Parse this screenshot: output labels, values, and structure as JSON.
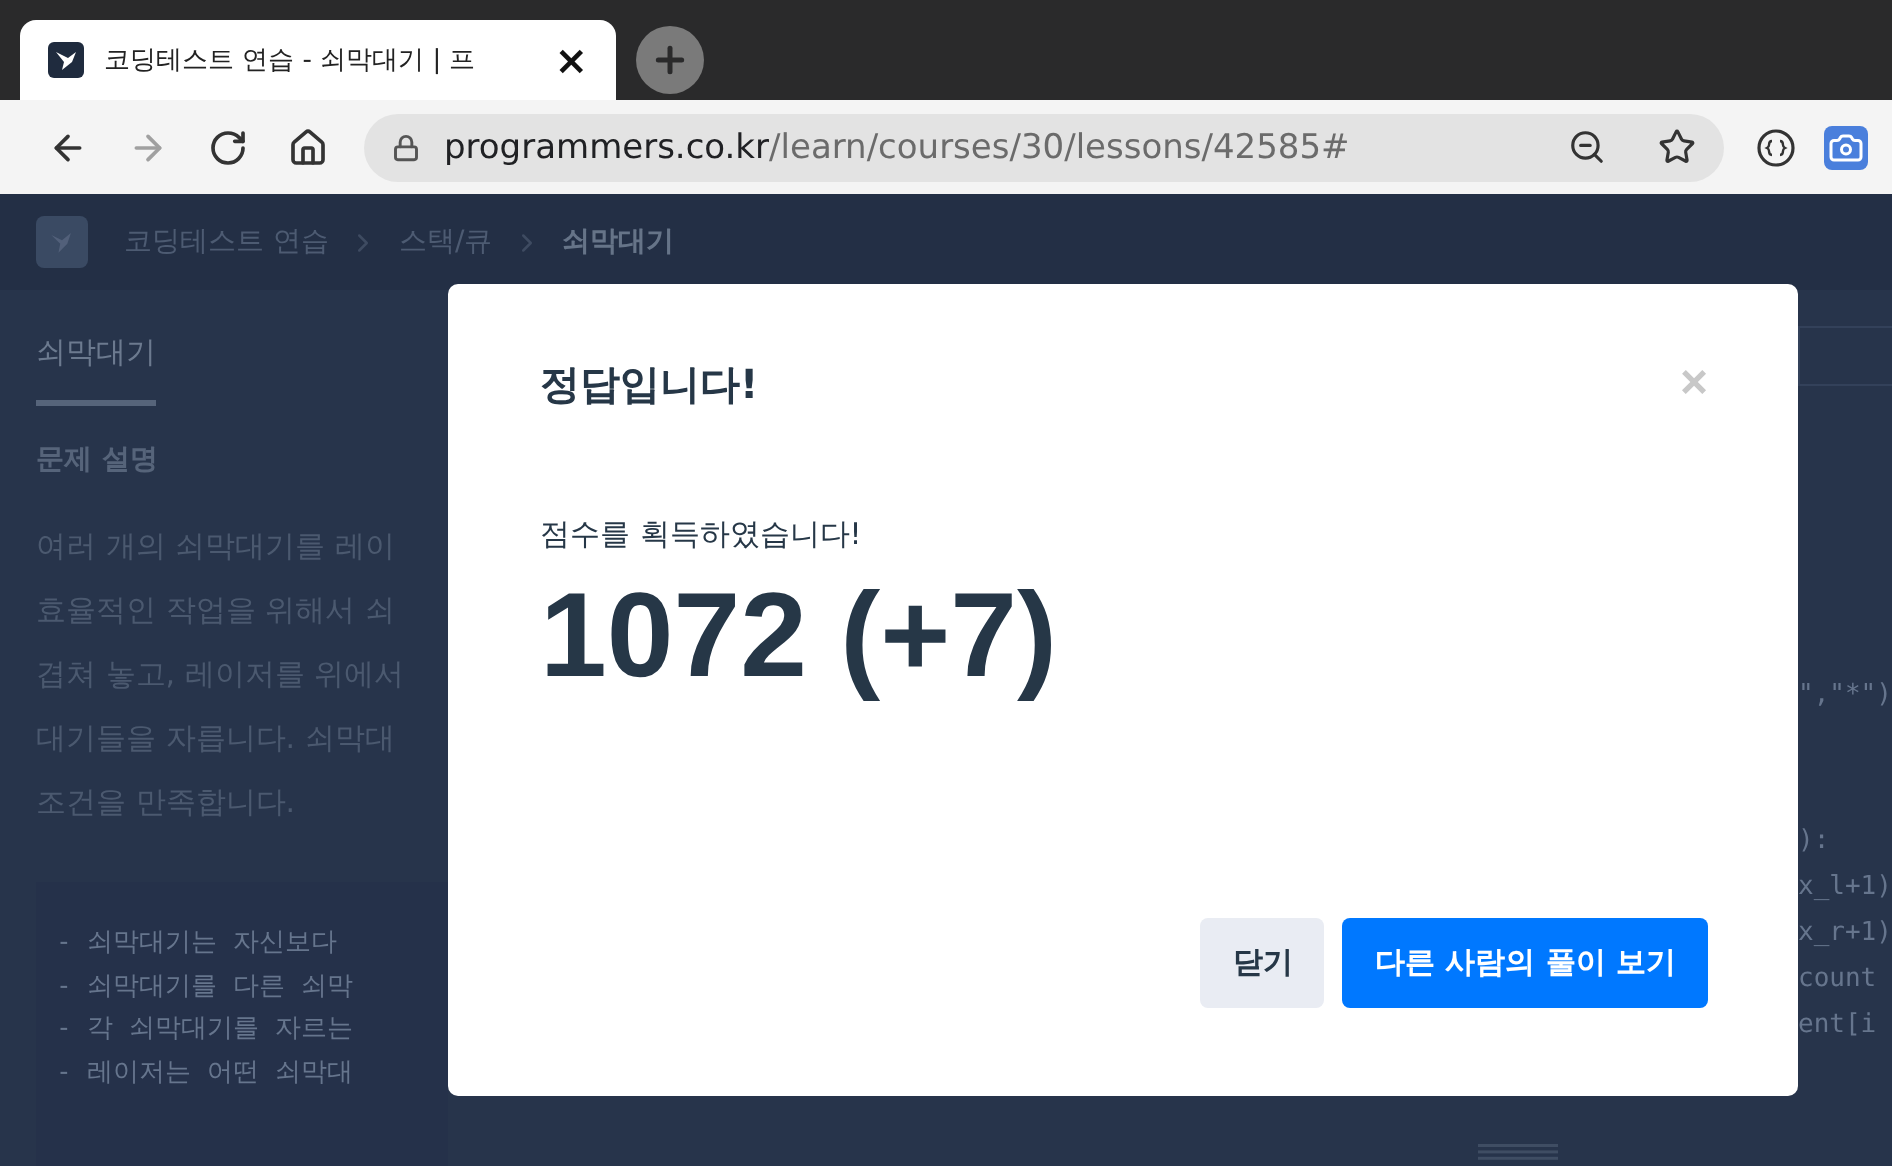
{
  "browser": {
    "tab": {
      "title": "코딩테스트 연습 - 쇠막대기 | 프",
      "close": "×"
    },
    "nav": [
      {
        "kind": "back",
        "disabled": false
      },
      {
        "kind": "forward",
        "disabled": true
      },
      {
        "kind": "reload",
        "disabled": false
      },
      {
        "kind": "home",
        "disabled": false
      }
    ],
    "address": {
      "host": "programmers.co.kr",
      "path": "/learn/courses/30/lessons/42585#"
    }
  },
  "page": {
    "breadcrumb": [
      {
        "label": "코딩테스트 연습",
        "current": false
      },
      {
        "label": "스택/큐",
        "current": false
      },
      {
        "label": "쇠막대기",
        "current": true
      }
    ],
    "tabs": [
      {
        "label": "쇠막대기",
        "selected": true
      }
    ],
    "section_title": "문제 설명",
    "paragraph_lines": [
      "여러 개의 쇠막대기를 레이",
      "효율적인 작업을 위해서 쇠",
      "겹쳐 놓고, 레이저를 위에서",
      "대기들을 자릅니다. 쇠막대",
      "조건을 만족합니다."
    ],
    "condition_lines": [
      "- 쇠막대기는 자신보다",
      "- 쇠막대기를 다른 쇠막",
      "- 각 쇠막대기를 자르는",
      "- 레이저는 어떤 쇠막대"
    ],
    "code_lines": [
      "\",\"*\")",
      "):",
      "x_l+1)",
      "x_r+1)",
      "count",
      "ent[i"
    ]
  },
  "modal": {
    "title": "정답입니다!",
    "close": "×",
    "message": "점수를 획득하였습니다!",
    "score": "1072 (+7)",
    "buttons": [
      {
        "label": "닫기",
        "kind": "secondary"
      },
      {
        "label": "다른 사람의 풀이 보기",
        "kind": "primary"
      }
    ]
  }
}
